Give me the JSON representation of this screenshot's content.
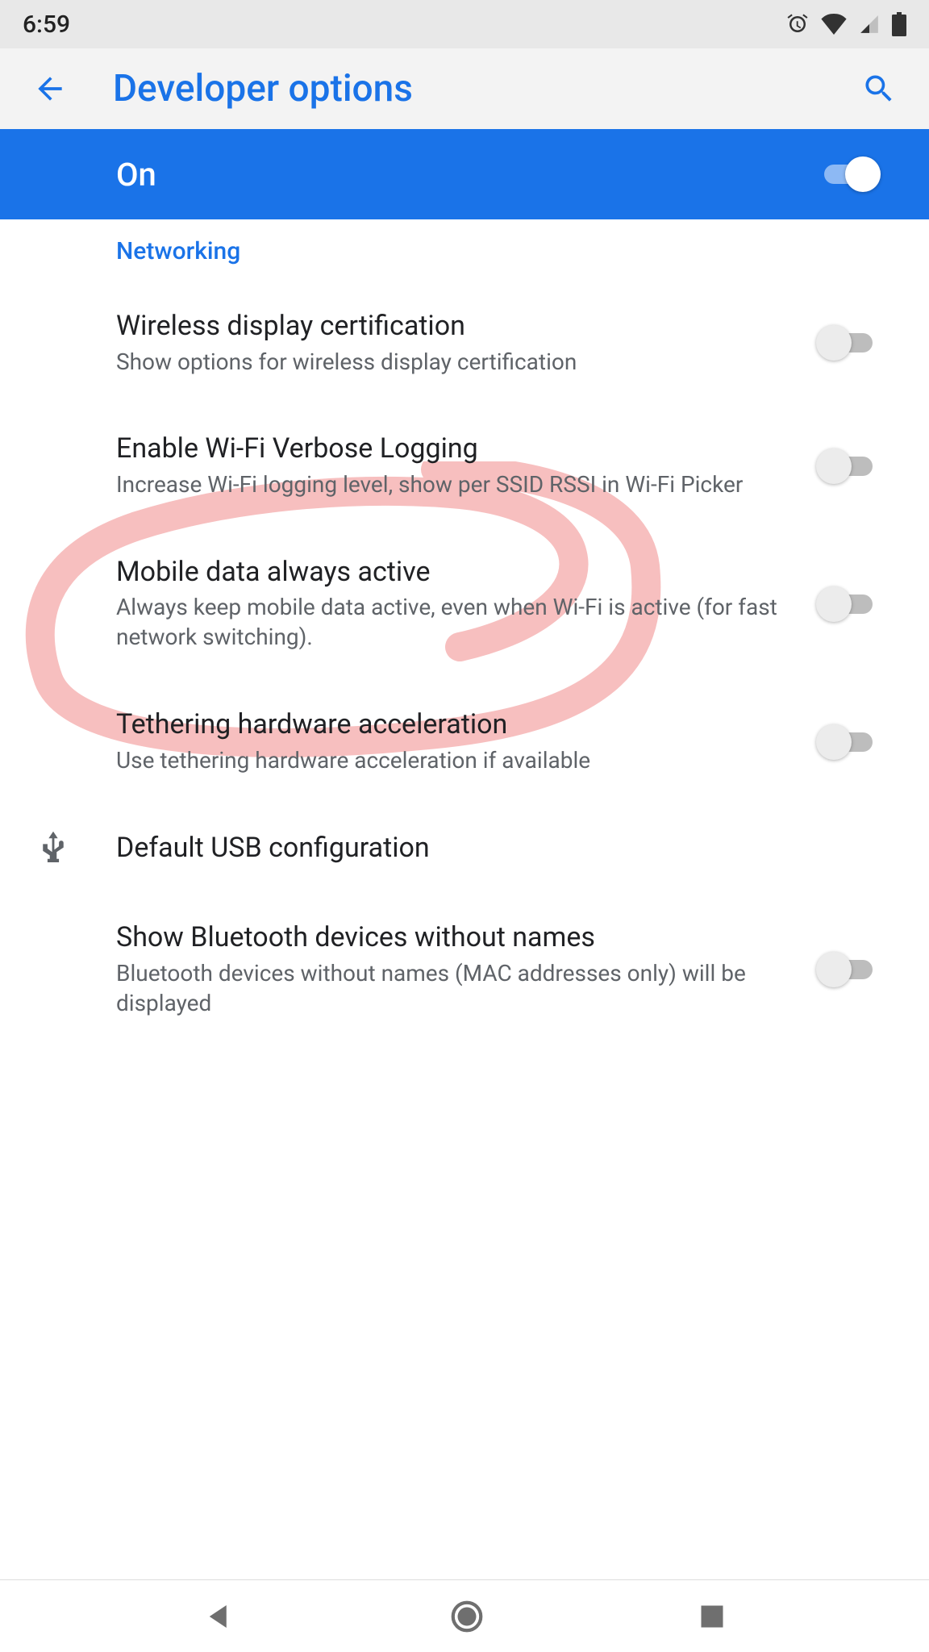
{
  "statusbar": {
    "time": "6:59"
  },
  "appbar": {
    "title": "Developer options"
  },
  "master": {
    "label": "On",
    "on": true
  },
  "section": "Networking",
  "settings": [
    {
      "title": "Wireless display certification",
      "desc": "Show options for wireless display certification",
      "toggle": "off"
    },
    {
      "title": "Enable Wi-Fi Verbose Logging",
      "desc": "Increase Wi-Fi logging level, show per SSID RSSI in Wi-Fi Picker",
      "toggle": "off"
    },
    {
      "title": "Mobile data always active",
      "desc": "Always keep mobile data active, even when Wi-Fi is active (for fast network switching).",
      "toggle": "off"
    },
    {
      "title": "Tethering hardware acceleration",
      "desc": "Use tethering hardware acceleration if available",
      "toggle": "off"
    },
    {
      "title": "Default USB configuration",
      "desc": "",
      "toggle": "none",
      "icon": "usb"
    },
    {
      "title": "Show Bluetooth devices without names",
      "desc": "Bluetooth devices without names (MAC addresses only) will be displayed",
      "toggle": "off"
    }
  ],
  "colors": {
    "accent": "#1a73e8",
    "annotation": "#f6b8b8"
  }
}
